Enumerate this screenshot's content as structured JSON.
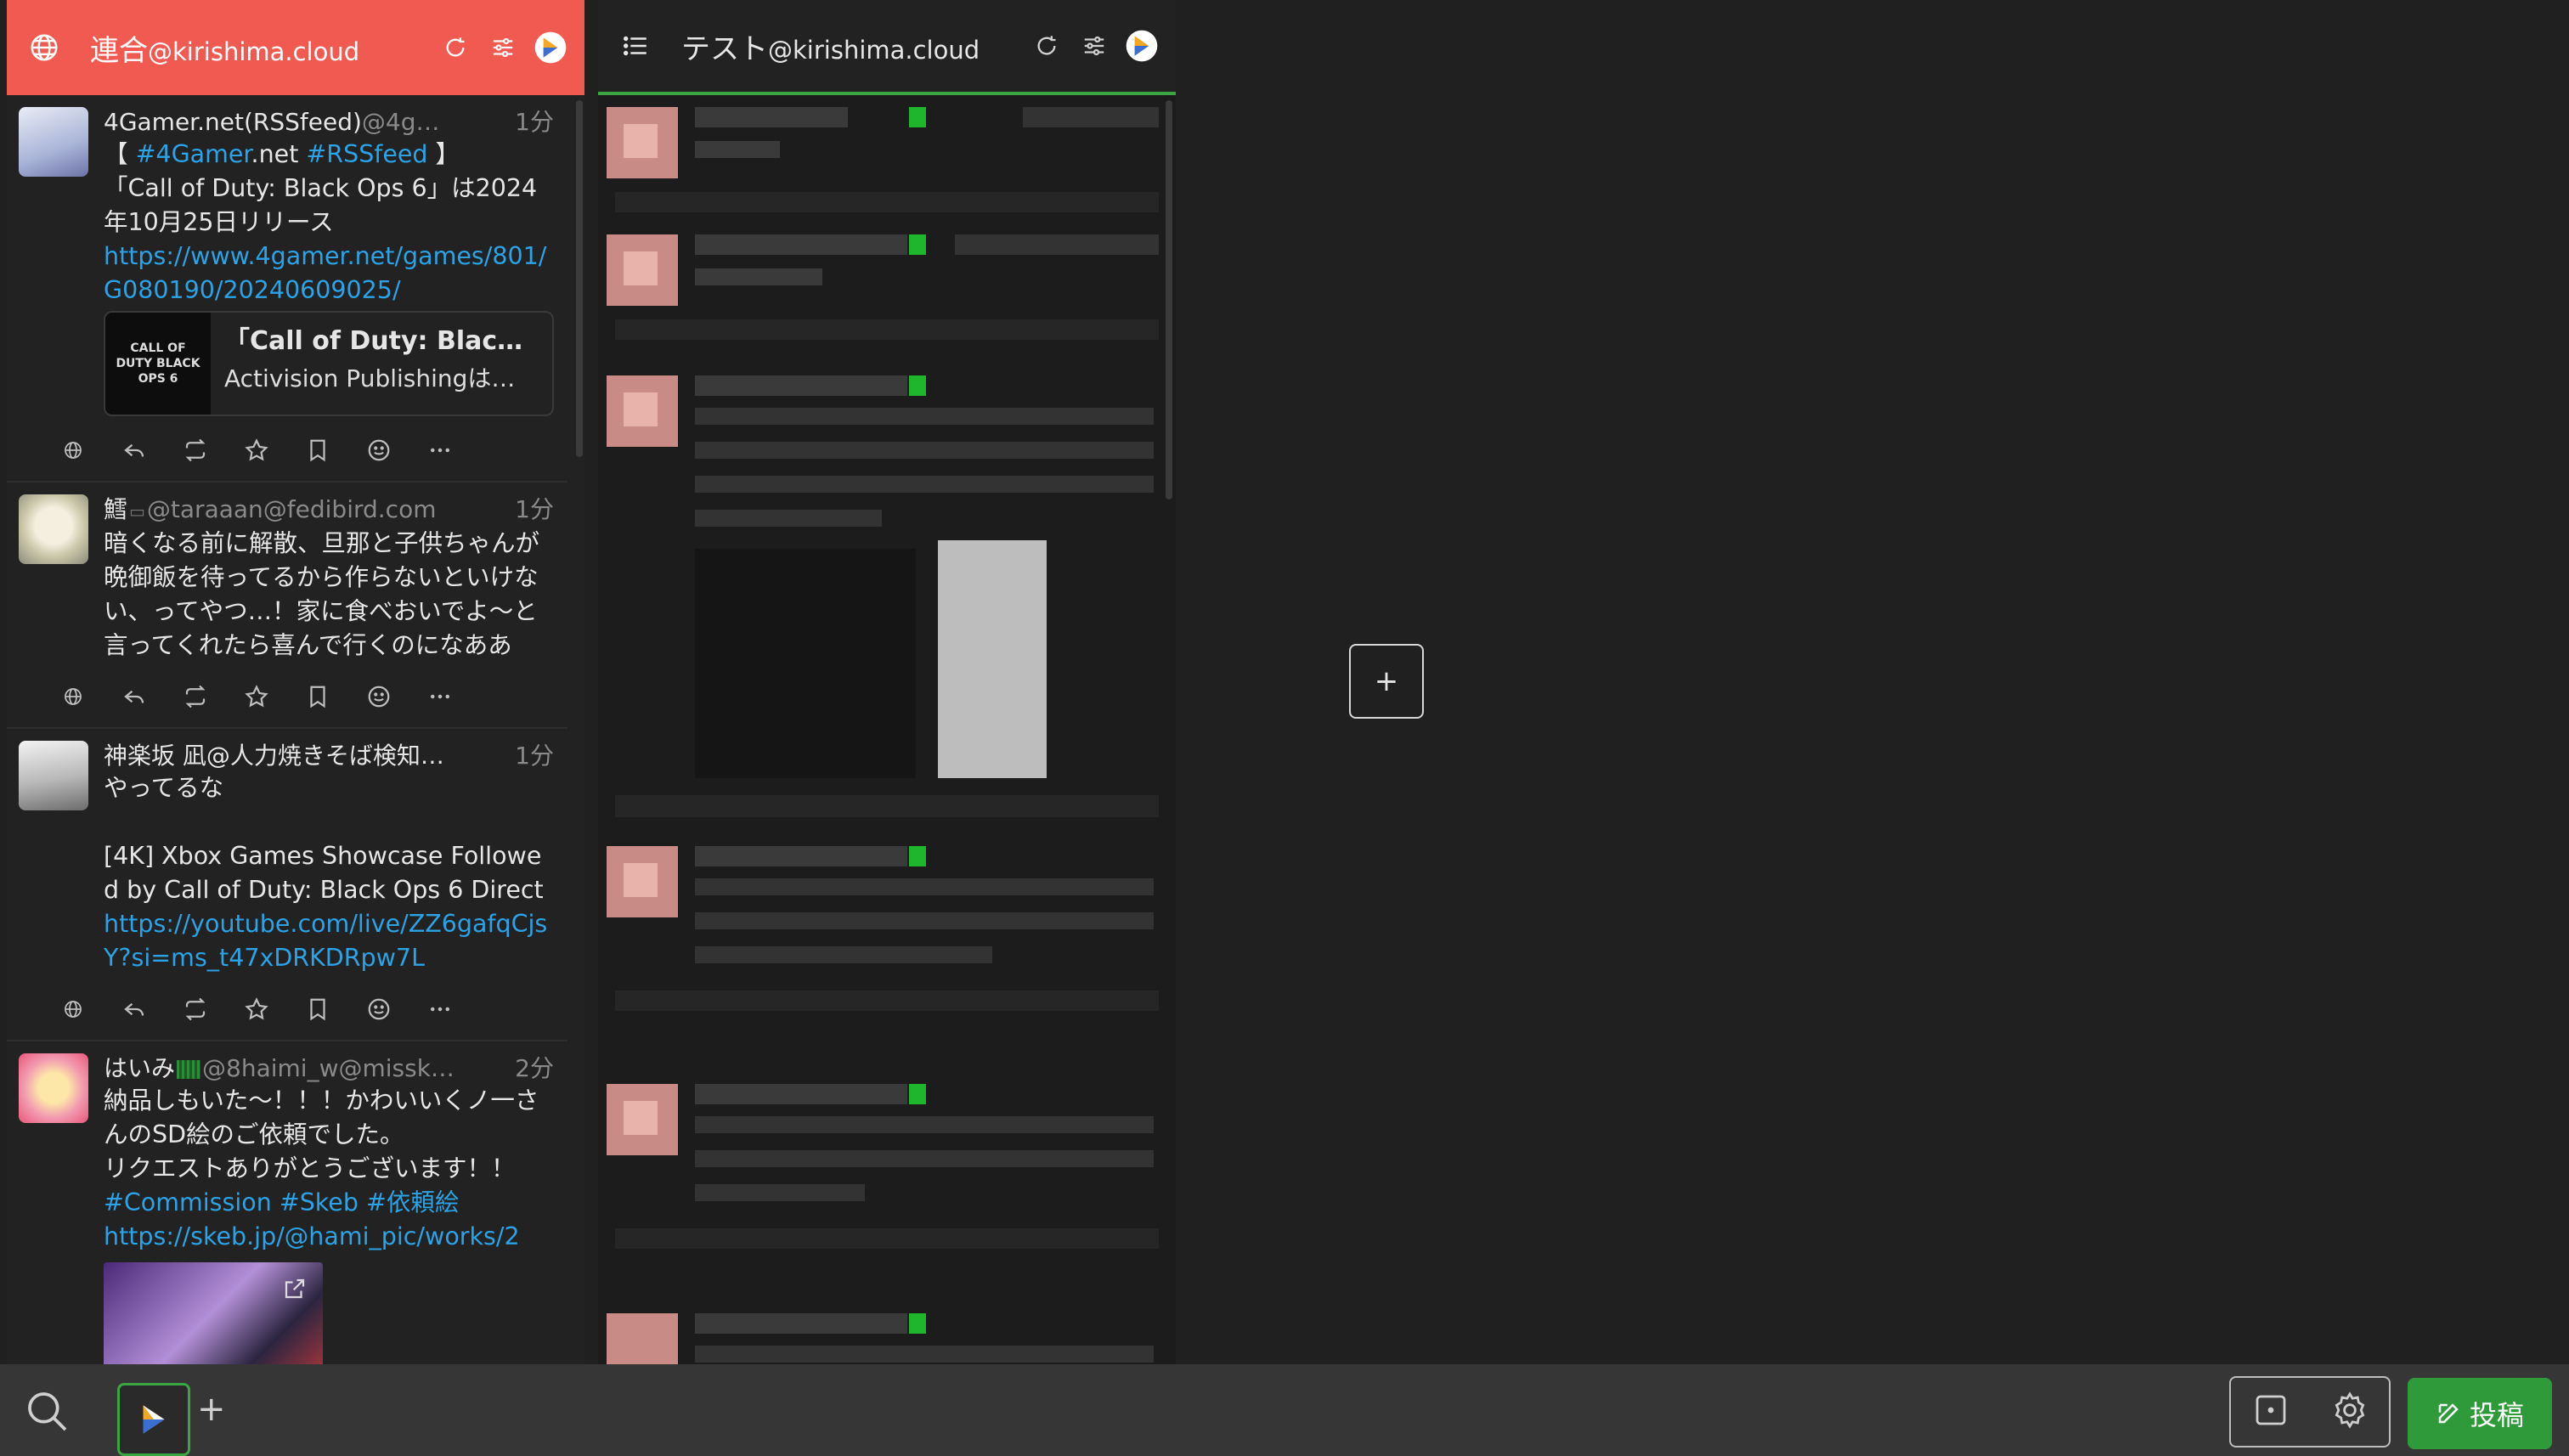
{
  "colors": {
    "column1_header": "#f05a50",
    "accent_green": "#2e9a3a",
    "link": "#2ba3e6"
  },
  "column1": {
    "title": "連合",
    "account": "@kirishima.cloud",
    "icons": [
      "globe-icon",
      "reload-icon",
      "filter-sliders-icon",
      "account-avatar-icon"
    ],
    "notes": [
      {
        "name": "4Gamer.net(RSSfeed)",
        "acct": "@4g…",
        "time": "1分",
        "lines": [
          "【 ",
          "#4Gamer",
          ".net ",
          "#RSSfeed",
          " 】"
        ],
        "text2": "「Call of Duty: Black Ops 6」は2024年10月25日リリース",
        "url": "https://www.4gamer.net/games/801/G080190/20240609025/",
        "card": {
          "thumb": "CALL OF DUTY BLACK OPS 6",
          "title": "「Call of Duty: Black Op…",
          "desc": "Activision Publishingは本…"
        }
      },
      {
        "name": "鱈",
        "acct": "@taraaan@fedibird.com",
        "time": "1分",
        "text": "暗くなる前に解散、旦那と子供ちゃんが晩御飯を待ってるから作らないといけない、ってやつ…！家に食べおいでよ〜と言ってくれたら喜んで行くのになああ"
      },
      {
        "name": "神楽坂 凪@人力焼きそば検知…",
        "acct": "",
        "time": "1分",
        "text1": "やってるな",
        "text2": "[4K] Xbox Games Showcase Followed by Call of Duty: Black Ops 6 Direct",
        "url": "https://youtube.com/live/ZZ6gafqCjsY?si=ms_t47xDRKDRpw7L"
      },
      {
        "name": "はいみ",
        "acct": "@8haimi_w@missk…",
        "time": "2分",
        "text1": "納品しもいた〜！！！かわいいくノ一さんのSD絵のご依頼でした。",
        "text2": "リクエストありがとうございます！！",
        "tags": "#Commission #Skeb #依頼絵",
        "url": "https://skeb.jp/@hami_pic/works/2"
      }
    ]
  },
  "column2": {
    "title": "テスト",
    "account": "@kirishima.cloud"
  },
  "add_column": {
    "label": "+"
  },
  "bottom": {
    "plus": "+",
    "post_label": "投稿"
  }
}
